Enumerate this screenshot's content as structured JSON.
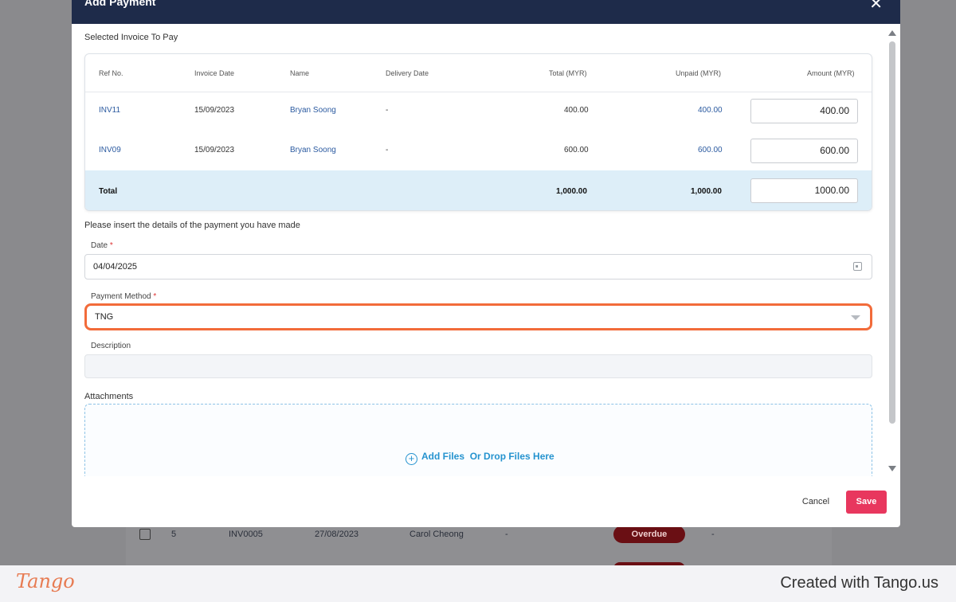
{
  "background": {
    "row": {
      "num": "5",
      "ref": "INV0005",
      "date": "27/08/2023",
      "name": "Carol Cheong",
      "dash1": "-",
      "status": "Overdue",
      "dash2": "-"
    }
  },
  "modal": {
    "title": "Add Payment",
    "selected_label": "Selected Invoice To Pay",
    "table": {
      "headers": [
        "Ref No.",
        "Invoice Date",
        "Name",
        "Delivery Date",
        "Total (MYR)",
        "Unpaid (MYR)",
        "Amount (MYR)"
      ],
      "rows": [
        {
          "ref": "INV11",
          "invoice_date": "15/09/2023",
          "name": "Bryan Soong",
          "delivery_date": "-",
          "total": "400.00",
          "unpaid": "400.00",
          "amount": "400.00"
        },
        {
          "ref": "INV09",
          "invoice_date": "15/09/2023",
          "name": "Bryan Soong",
          "delivery_date": "-",
          "total": "600.00",
          "unpaid": "600.00",
          "amount": "600.00"
        }
      ],
      "total_row": {
        "label": "Total",
        "total": "1,000.00",
        "unpaid": "1,000.00",
        "amount": "1000.00"
      }
    },
    "details_label": "Please insert the details of the payment you have made",
    "date": {
      "label": "Date",
      "required": "*",
      "value": "04/04/2025"
    },
    "payment_method": {
      "label": "Payment Method",
      "required": "*",
      "value": "TNG"
    },
    "description": {
      "label": "Description",
      "value": ""
    },
    "attachments": {
      "label": "Attachments",
      "add_files": "Add Files",
      "drop_text": "Or Drop Files Here"
    },
    "cancel_label": "Cancel",
    "save_label": "Save"
  },
  "tango": {
    "logo": "Tango",
    "credit": "Created with Tango.us"
  },
  "colors": {
    "header": "#1e2b4a",
    "highlight": "#f26b3a",
    "save": "#e8375e",
    "link": "#2b5aa0",
    "total_row": "#ddeef8"
  }
}
